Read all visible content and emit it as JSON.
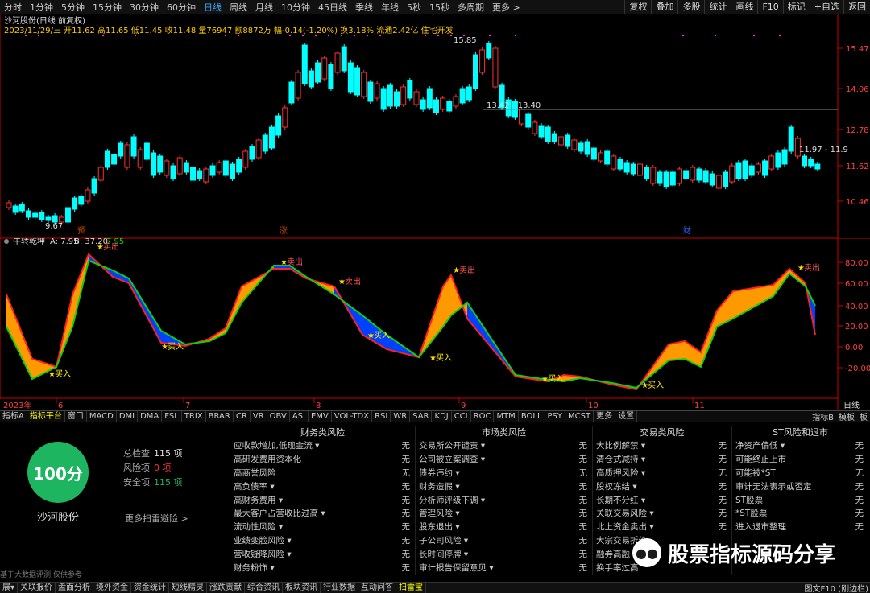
{
  "top_bar": {
    "timeframes": [
      "分时",
      "1分钟",
      "5分钟",
      "15分钟",
      "30分钟",
      "60分钟",
      "日线",
      "周线",
      "月线",
      "10分钟",
      "45日线",
      "季线",
      "年线",
      "5秒",
      "15秒",
      "多周期",
      "更多 >"
    ],
    "active_timeframe": "日线",
    "right_tools": [
      "复权",
      "叠加",
      "多股",
      "统计",
      "画线",
      "F10",
      "标记",
      "+自选",
      "返回"
    ]
  },
  "chart_header": {
    "title": "沙河股份(日线 前复权)",
    "quote": "2023/11/29/三 开11.62 高11.65 低11.45 收11.48 量76947 额8872万 幅-0.14(-1.20%) 换3.18% 流通2.42亿 住宅开发"
  },
  "price_axis": [
    "15.47",
    "14.06",
    "12.78",
    "11.62",
    "10.46"
  ],
  "price_annotations": {
    "high_label": "15.85",
    "low_label": "9.67",
    "level_label_1": "13.42 - 13.40",
    "level_label_2": "11.97 - 11.9"
  },
  "event_markers": [
    "预",
    "涨",
    "财"
  ],
  "indicator": {
    "name": "牛转乾坤",
    "a_label": "A: 7.95",
    "b_label": "B: 37.20",
    "c_label": "7.95",
    "axis": [
      "80.00",
      "60.00",
      "40.00",
      "20.00",
      "0.00",
      "-20.00"
    ],
    "signals": [
      {
        "text": "卖出",
        "kind": "sell"
      },
      {
        "text": "买入",
        "kind": "buy"
      },
      {
        "text": "卖出",
        "kind": "sell"
      },
      {
        "text": "买入",
        "kind": "buy"
      },
      {
        "text": "卖出",
        "kind": "sell"
      },
      {
        "text": "买入",
        "kind": "buy"
      },
      {
        "text": "卖出",
        "kind": "sell"
      },
      {
        "text": "买入",
        "kind": "buy"
      },
      {
        "text": "买入",
        "kind": "buy"
      },
      {
        "text": "买入",
        "kind": "buy"
      },
      {
        "text": "卖出",
        "kind": "sell"
      }
    ]
  },
  "x_axis": {
    "year": "2023年",
    "months": [
      "6",
      "7",
      "8",
      "9",
      "10",
      "11"
    ],
    "period_label": "日线"
  },
  "indicator_tabs": [
    "指标A",
    "指标平台",
    "窗口",
    "MACD",
    "DMI",
    "DMA",
    "FSL",
    "TRIX",
    "BRAR",
    "CR",
    "VR",
    "OBV",
    "ASI",
    "EMV",
    "VOL-TDX",
    "RSI",
    "WR",
    "SAR",
    "KDJ",
    "CCI",
    "ROC",
    "MTM",
    "BOLL",
    "PSY",
    "MCST",
    "更多",
    "设置"
  ],
  "indicator_tabs_right": [
    "指标B",
    "模板",
    "板"
  ],
  "risk_scan": {
    "score": "100分",
    "stock_name": "沙河股份",
    "total_label": "总检查",
    "total_value": "115 项",
    "risk_label": "风险项",
    "risk_value": "0 项",
    "safe_label": "安全项",
    "safe_value": "115 项",
    "more_link": "更多扫雷避险 >",
    "columns": [
      {
        "title": "财务类风险",
        "items": [
          {
            "label": "应收款增加,低现金流 ▾",
            "value": "无"
          },
          {
            "label": "高研发费用资本化",
            "value": "无"
          },
          {
            "label": "高商誉风险",
            "value": "无"
          },
          {
            "label": "高负债率 ▾",
            "value": "无"
          },
          {
            "label": "高财务费用 ▾",
            "value": "无"
          },
          {
            "label": "最大客户占营收比过高 ▾",
            "value": "无"
          },
          {
            "label": "流动性风险 ▾",
            "value": "无"
          },
          {
            "label": "业绩变脸风险 ▾",
            "value": "无"
          },
          {
            "label": "营收疑降风险 ▾",
            "value": "无"
          },
          {
            "label": "财务粉饰 ▾",
            "value": "无"
          }
        ]
      },
      {
        "title": "市场类风险",
        "items": [
          {
            "label": "交易所公开谴责 ▾",
            "value": "无"
          },
          {
            "label": "公司被立案调查 ▾",
            "value": "无"
          },
          {
            "label": "债券违约 ▾",
            "value": "无"
          },
          {
            "label": "财务造假 ▾",
            "value": "无"
          },
          {
            "label": "分析师评级下调 ▾",
            "value": "无"
          },
          {
            "label": "管理风险 ▾",
            "value": "无"
          },
          {
            "label": "股东退出 ▾",
            "value": "无"
          },
          {
            "label": "子公司风险 ▾",
            "value": "无"
          },
          {
            "label": "长时间停牌 ▾",
            "value": "无"
          },
          {
            "label": "审计报告保留意见 ▾",
            "value": "无"
          }
        ]
      },
      {
        "title": "交易类风险",
        "items": [
          {
            "label": "大比例解禁 ▾",
            "value": "无"
          },
          {
            "label": "清仓式减持 ▾",
            "value": "无"
          },
          {
            "label": "高质押风险 ▾",
            "value": "无"
          },
          {
            "label": "股权冻结 ▾",
            "value": "无"
          },
          {
            "label": "长期不分红 ▾",
            "value": "无"
          },
          {
            "label": "关联交易风险 ▾",
            "value": "无"
          },
          {
            "label": "北上资金卖出 ▾",
            "value": "无"
          },
          {
            "label": "大宗交易折价",
            "value": ""
          },
          {
            "label": "融券高融",
            "value": ""
          },
          {
            "label": "换手率过高",
            "value": ""
          }
        ]
      },
      {
        "title": "ST风险和退市",
        "items": [
          {
            "label": "净资产偏低 ▾",
            "value": "无"
          },
          {
            "label": "可能终止上市",
            "value": "无"
          },
          {
            "label": "可能被*ST",
            "value": "无"
          },
          {
            "label": "审计无法表示或否定",
            "value": "无"
          },
          {
            "label": "ST股票",
            "value": "无"
          },
          {
            "label": "*ST股票",
            "value": "无"
          },
          {
            "label": "进入退市整理",
            "value": "无"
          },
          {
            "label": "",
            "value": ""
          },
          {
            "label": "",
            "value": ""
          },
          {
            "label": "",
            "value": ""
          }
        ]
      }
    ]
  },
  "watermark": {
    "text": "股票指标源码分享"
  },
  "footer_note": "基于大数据评测,仅供参考",
  "bottom_tabs": [
    "展▾",
    "关联报价",
    "盘面分析",
    "境外资金",
    "资金统计",
    "短线精灵",
    "涨跌贡献",
    "综合资讯",
    "板块资讯",
    "行业数据",
    "互动问答",
    "扫雷宝"
  ],
  "active_bottom_tab": "扫雷宝",
  "bottom_right": "图文F10 (刚边栏)",
  "colors": {
    "up": "#ff3030",
    "down": "#00ffff",
    "orange": "#ff9900",
    "blue": "#0040ff",
    "green": "#00cc00",
    "score_green": "#1eb560"
  }
}
